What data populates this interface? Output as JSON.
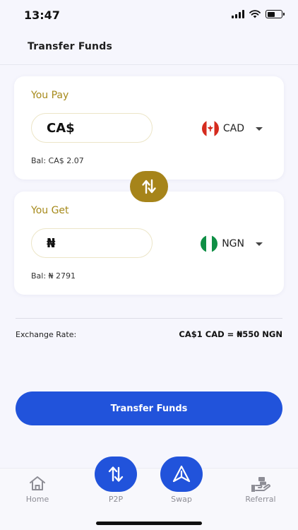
{
  "status_bar": {
    "time": "13:47"
  },
  "header": {
    "title": "Transfer Funds"
  },
  "pay_card": {
    "label": "You Pay",
    "amount_prefix": "CA$",
    "currency_code": "CAD",
    "balance": "Bal: CA$ 2.07",
    "flag_icon": "canada-flag-icon"
  },
  "get_card": {
    "label": "You Get",
    "amount_prefix": "₦",
    "currency_code": "NGN",
    "balance": "Bal: ₦ 2791",
    "flag_icon": "nigeria-flag-icon"
  },
  "exchange": {
    "label": "Exchange Rate:",
    "value": "CA$1 CAD = ₦550 NGN"
  },
  "actions": {
    "transfer_label": "Transfer Funds"
  },
  "nav": {
    "items": [
      {
        "label": "Home",
        "icon": "home-icon"
      },
      {
        "label": "P2P",
        "icon": "p2p-arrows-icon"
      },
      {
        "label": "Swap",
        "icon": "swap-triangle-icon"
      },
      {
        "label": "Referral",
        "icon": "referral-hand-icon"
      }
    ]
  },
  "colors": {
    "accent_gold": "#a6841a",
    "primary_blue": "#2153db",
    "background": "#f6f6fd"
  }
}
